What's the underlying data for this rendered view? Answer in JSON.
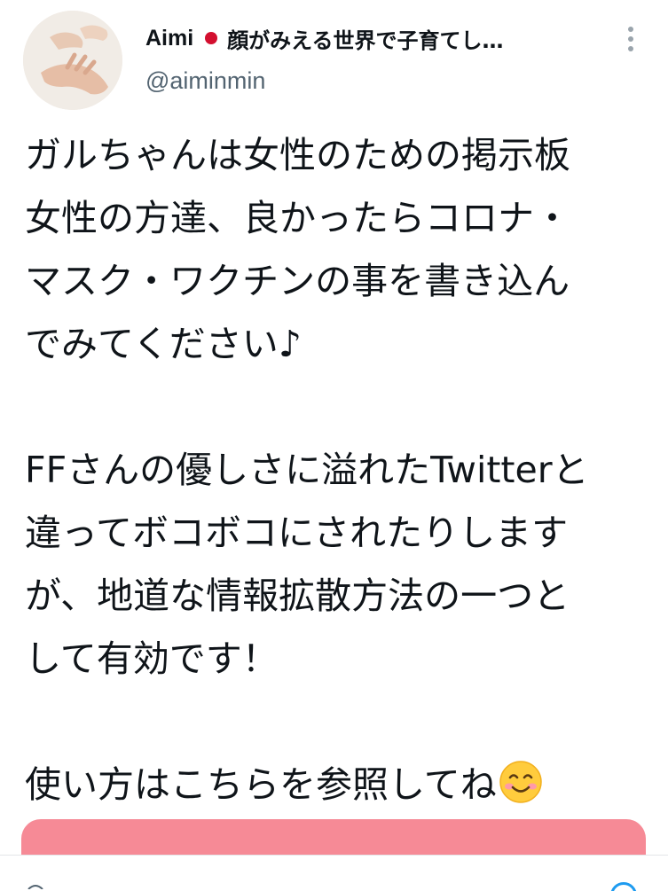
{
  "author": {
    "display_name": "Aimi",
    "flag_icon": "japan-flag-icon",
    "name_suffix": "顔がみえる世界で子育てし…",
    "handle": "@aiminmin"
  },
  "tweet": {
    "lines_p1": [
      "ガルちゃんは女性のための掲示板",
      "女性の方達、良かったらコロナ・",
      "マスク・ワクチンの事を書き込ん",
      "でみてください♪"
    ],
    "lines_p2": [
      "FFさんの優しさに溢れたTwitterと",
      "違ってボコボコにされたりします",
      "が、地道な情報拡散方法の一つと",
      "して有効です！"
    ],
    "line_p3": "使い方はこちらを参照してね",
    "emoji": "smiling-face-emoji"
  },
  "colors": {
    "card": "#f68a96",
    "handle": "#536471",
    "flag": "#d30f2f",
    "accent": "#1d9bf0"
  }
}
